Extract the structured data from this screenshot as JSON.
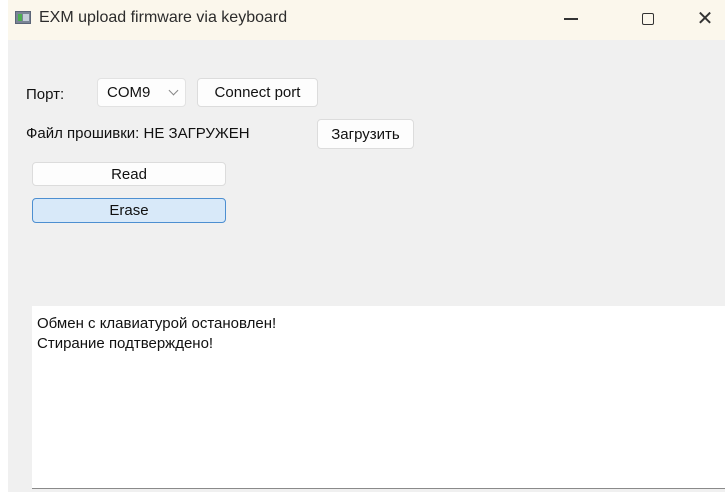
{
  "window": {
    "title": "EXM upload firmware via keyboard",
    "icon": "app-window-icon",
    "controls": {
      "minimize_icon": "minimize-icon",
      "maximize_icon": "maximize-icon",
      "close_glyph": "✕"
    }
  },
  "port": {
    "label": "Порт:",
    "selected": "COM9",
    "connect_label": "Connect port"
  },
  "firmware": {
    "label": "Файл прошивки: НЕ ЗАГРУЖЕН",
    "load_label": "Загрузить"
  },
  "actions": {
    "read_label": "Read",
    "erase_label": "Erase"
  },
  "log": {
    "lines": [
      "Обмен с клавиатурой остановлен!",
      "Стирание подтверждено!"
    ]
  },
  "colors": {
    "window_bg": "#f0f0f0",
    "titlebar_bg": "#fbf7ec",
    "focus_accent": "#4d8fd1",
    "focus_fill": "#d8e9f9"
  }
}
